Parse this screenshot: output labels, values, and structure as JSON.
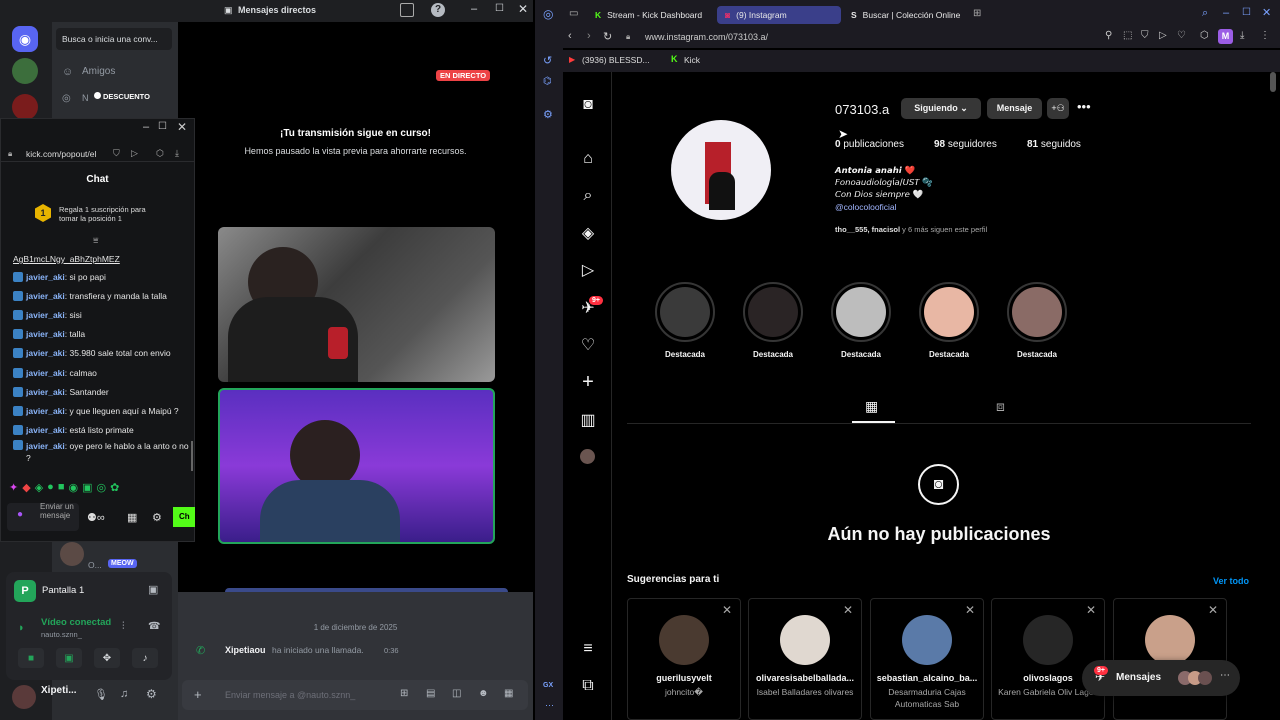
{
  "discord": {
    "window_title": "Mensajes directos",
    "search_placeholder": "Busca o inicia una conv...",
    "friends_label": "Amigos",
    "dm_initial": "N",
    "rest_badge": "DESCUENTO",
    "live_badge": "EN DIRECTO",
    "stream_paused_title": "¡Tu transmisión sigue en curso!",
    "stream_paused_text": "Hemos pausado la vista previa para ahorrarte recursos.",
    "date_divider": "1 de diciembre de 2025",
    "call_user": "Xipetiaou",
    "call_text": "ha iniciado una llamada.",
    "call_duration": "0:36",
    "message_placeholder": "Enviar mensaje a @nauto.sznn_",
    "dm_partial_name": "O...",
    "dm_partial_badge": "MEOW",
    "voice_channel": "Pantalla 1",
    "voice_status": "Vídeo conectad",
    "voice_server": "nauto.sznn_",
    "user_name": "Xipeti...",
    "colors": {
      "blurple": "#5865f2",
      "green": "#23a55a",
      "red": "#ed4245"
    }
  },
  "kick": {
    "url": "kick.com/popout/el",
    "chat_title": "Chat",
    "gift_rank": "1",
    "gift_text": "Regala 1 suscripción para tomar la posición 1",
    "link_text_1": "AgB1mcLNgy_aBhZtphMEZ",
    "messages": [
      {
        "user": "javier_aki",
        "text": "si po papi"
      },
      {
        "user": "javier_aki",
        "text": "transfiera y manda la talla"
      },
      {
        "user": "javier_aki",
        "text": "sisi"
      },
      {
        "user": "javier_aki",
        "text": "talla"
      },
      {
        "user": "javier_aki",
        "text": "35.980 sale total con envio"
      },
      {
        "user": "javier_aki",
        "text": "calmao"
      },
      {
        "user": "javier_aki",
        "text": "Santander"
      },
      {
        "user": "javier_aki",
        "text": "y que lleguen aquí a Maipú ?"
      },
      {
        "user": "javier_aki",
        "text": "está listo primate"
      },
      {
        "user": "javier_aki",
        "text": "oye pero le hablo a la anto o no ?"
      }
    ],
    "send_placeholder": "Enviar un mensaje",
    "chat_button": "Ch",
    "accent": "#53fc18"
  },
  "browser": {
    "tabs": [
      {
        "label": "Stream - Kick Dashboard"
      },
      {
        "label": "(9) Instagram"
      },
      {
        "label": "Buscar | Colección Online"
      }
    ],
    "url": "www.instagram.com/073103.a/",
    "bookmarks": [
      {
        "label": "(3936) BLESSD..."
      },
      {
        "label": "Kick"
      }
    ],
    "profile_initial": "M",
    "notif_badge": "9+"
  },
  "instagram": {
    "username": "073103.a",
    "follow_button": "Siguiendo",
    "message_button": "Mensaje",
    "stats": {
      "posts": "0",
      "posts_label": "publicaciones",
      "followers": "98",
      "followers_label": "seguidores",
      "following": "81",
      "following_label": "seguidos"
    },
    "bio": {
      "name": "𝘼𝙣𝙩𝙤𝙣𝙞𝙖 𝙖𝙣𝙖𝙝𝙞 ❤️",
      "line1": "𝘍𝘰𝘯𝘰𝘢𝘶𝘥𝘪𝘰𝘭𝘰𝘨í𝘢/𝘜𝘚𝘛 🫧",
      "line2": "𝘊𝘰𝘯 𝘋𝘪𝘰𝘴 𝘴𝘪𝘦𝘮𝘱𝘳𝘦 🤍",
      "mention": "@colocolooficial"
    },
    "followed_by_users": "tho__555, fnacisol",
    "followed_by_rest": "y 6 más siguen este perfil",
    "highlights": [
      {
        "label": "Destacada",
        "color": "#3a3a3a"
      },
      {
        "label": "Destacada",
        "color": "#2a2425"
      },
      {
        "label": "Destacada",
        "color": "#bdbdbd"
      },
      {
        "label": "Destacada",
        "color": "#e8b7a4"
      },
      {
        "label": "Destacada",
        "color": "#8a6b66"
      }
    ],
    "empty_title": "Aún no hay publicaciones",
    "suggestions_title": "Sugerencias para ti",
    "see_all": "Ver todo",
    "suggestions": [
      {
        "username": "guerilusyvelt",
        "fullname": "johncito�",
        "color": "#4a3a30"
      },
      {
        "username": "olivaresisabelballada...",
        "fullname": "Isabel Balladares olivares",
        "color": "#e0d8d0"
      },
      {
        "username": "sebastian_alcaino_ba...",
        "fullname": "Desarmaduria Cajas Automaticas Sab",
        "color": "#5a7aa8"
      },
      {
        "username": "olivoslagos",
        "fullname": "Karen Gabriela Oliv Lagos",
        "color": "#262626"
      },
      {
        "username": "",
        "fullname": "",
        "color": "#c9a08a"
      }
    ],
    "messages_pill": "Mensajes",
    "messages_badge": "9+"
  }
}
